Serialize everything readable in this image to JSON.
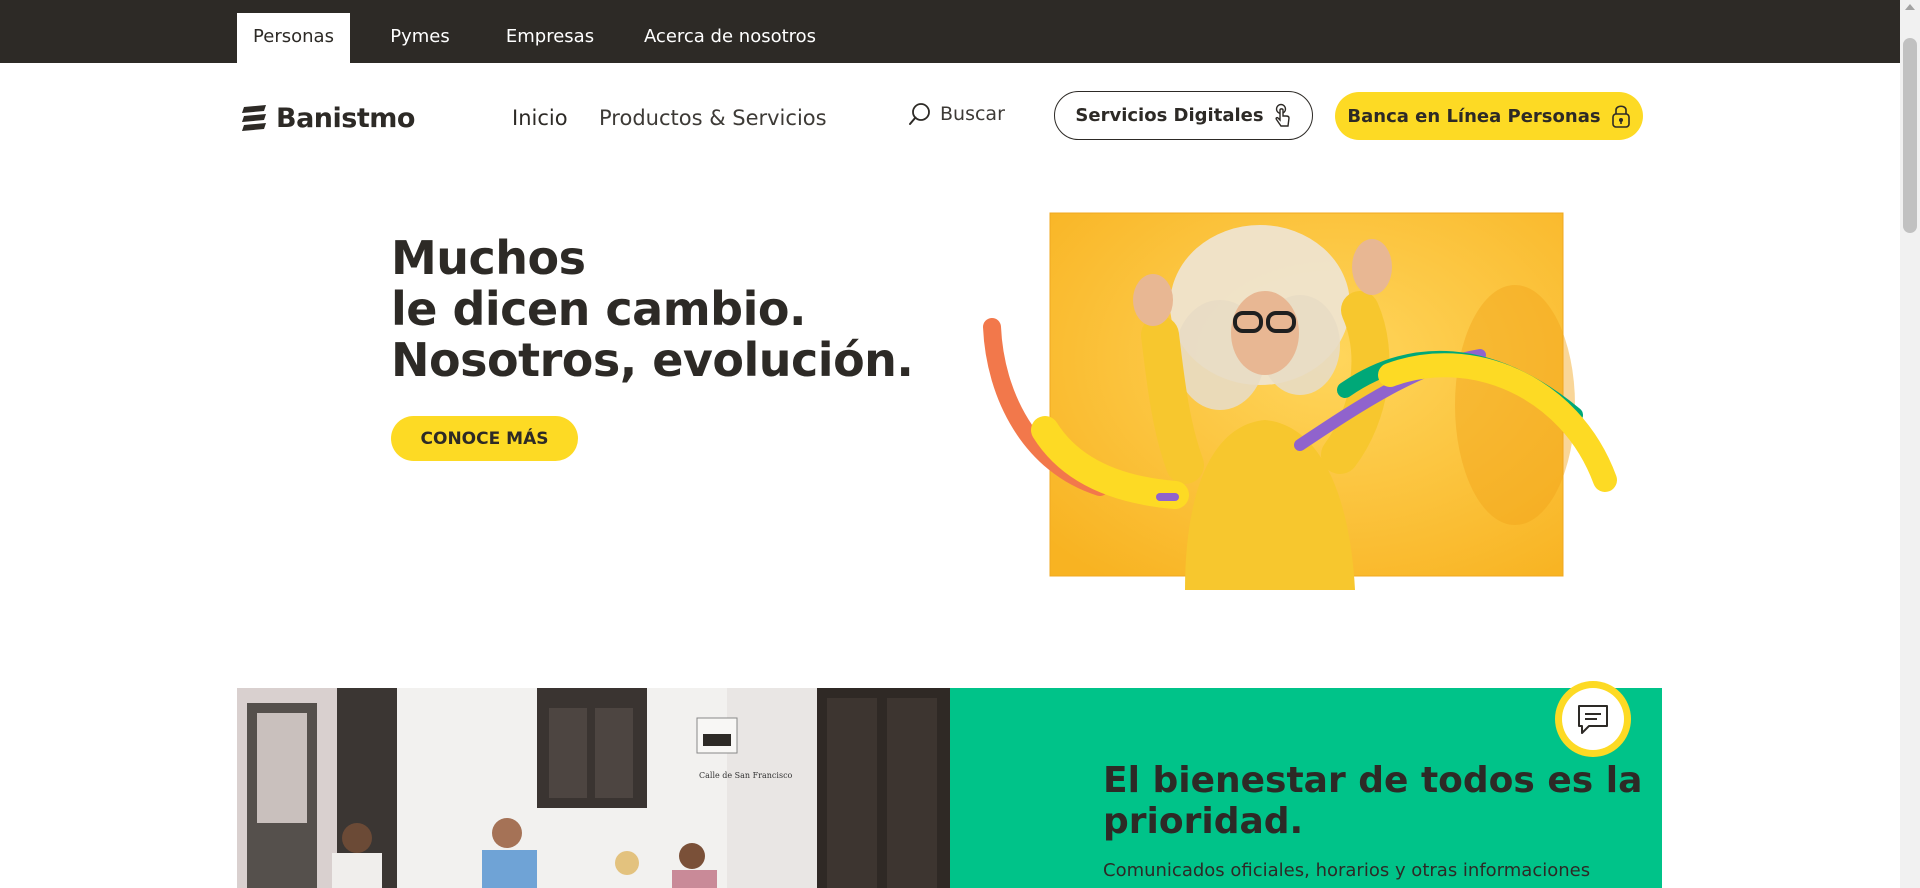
{
  "topbar": {
    "tabs": [
      {
        "label": "Personas",
        "active": true
      },
      {
        "label": "Pymes",
        "active": false
      },
      {
        "label": "Empresas",
        "active": false
      },
      {
        "label": "Acerca de nosotros",
        "active": false
      }
    ]
  },
  "header": {
    "logo_text": "Banistmo",
    "nav": [
      "Inicio",
      "Productos & Servicios"
    ],
    "search_label": "Buscar",
    "digital_services_label": "Servicios Digitales",
    "online_banking_label": "Banca en Línea Personas"
  },
  "hero": {
    "title_lines": [
      "Muchos",
      "le dicen cambio.",
      "Nosotros, evolución."
    ],
    "cta_label": "CONOCE MÁS"
  },
  "wellbeing": {
    "title_lines": [
      "El bienestar de todos es la",
      "prioridad."
    ],
    "text": "Comunicados oficiales, horarios y otras informaciones",
    "street_sign": "Calle de San Francisco"
  },
  "colors": {
    "dark": "#2d2a26",
    "brand_yellow": "#fdda24",
    "brand_green": "#00c389",
    "accent_orange": "#f2784b",
    "accent_purple": "#9063cd",
    "accent_teal": "#00a878"
  },
  "icons": {
    "logo": "banistmo-logo-icon",
    "search": "search-icon",
    "digital": "tap-hand-icon",
    "banking": "lock-icon",
    "chat": "chat-icon"
  }
}
